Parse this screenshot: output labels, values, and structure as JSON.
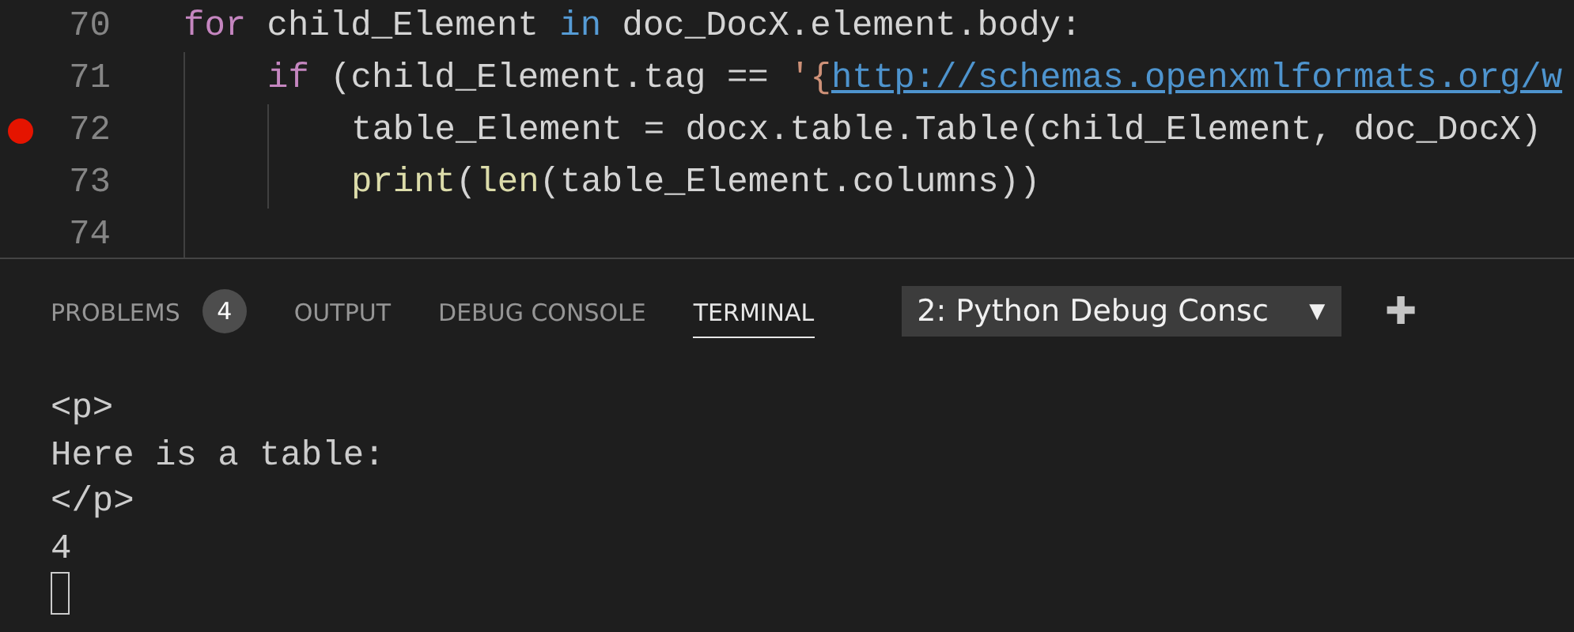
{
  "editor": {
    "lines": [
      {
        "number": "70",
        "breakpoint": false,
        "tokens": [
          {
            "kind": "control",
            "text": "for"
          },
          {
            "kind": "plain",
            "text": " child_Element "
          },
          {
            "kind": "keyword",
            "text": "in"
          },
          {
            "kind": "plain",
            "text": " doc_DocX.element.body:"
          }
        ],
        "children": [
          {
            "number": "71",
            "breakpoint": false,
            "tokens": [
              {
                "kind": "control",
                "text": "if"
              },
              {
                "kind": "plain",
                "text": " (child_Element.tag == "
              },
              {
                "kind": "string",
                "text": "'{"
              },
              {
                "kind": "link",
                "text": "http://schemas.openxmlformats.org/w"
              }
            ],
            "children": [
              {
                "number": "72",
                "breakpoint": true,
                "tokens": [
                  {
                    "kind": "plain",
                    "text": "table_Element = docx.table.Table(child_Element, doc_DocX)"
                  }
                ]
              },
              {
                "number": "73",
                "breakpoint": false,
                "tokens": [
                  {
                    "kind": "function",
                    "text": "print"
                  },
                  {
                    "kind": "plain",
                    "text": "("
                  },
                  {
                    "kind": "function",
                    "text": "len"
                  },
                  {
                    "kind": "plain",
                    "text": "(table_Element.columns))"
                  }
                ]
              }
            ]
          },
          {
            "number": "74",
            "breakpoint": false
          }
        ]
      }
    ]
  },
  "panel": {
    "tabs": [
      {
        "label": "PROBLEMS",
        "badge": "4",
        "selected": false
      },
      {
        "label": "OUTPUT",
        "selected": false
      },
      {
        "label": "DEBUG CONSOLE",
        "selected": false
      },
      {
        "label": "TERMINAL",
        "selected": true
      }
    ],
    "terminal_select": {
      "value": "2: Python Debug Consc",
      "caret": "▼"
    },
    "new_terminal": "✚",
    "terminal_lines": [
      "<p>",
      "Here is a table:",
      "</p>",
      "4"
    ]
  }
}
